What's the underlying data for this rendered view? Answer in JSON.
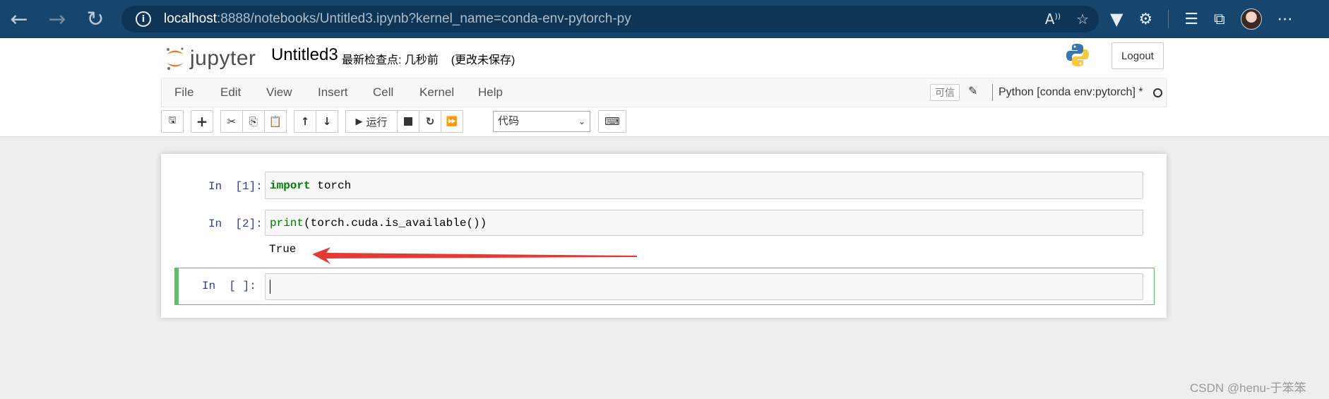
{
  "browser": {
    "url_host": "localhost",
    "url_rest": ":8888/notebooks/Untitled3.ipynb?kernel_name=conda-env-pytorch-py",
    "back_icon": "←",
    "forward_icon": "→",
    "reload_icon": "↻"
  },
  "header": {
    "logo_text": "jupyter",
    "notebook_title": "Untitled3",
    "checkpoint_status": "最新检查点: 几秒前",
    "save_status": "(更改未保存)",
    "logout_label": "Logout"
  },
  "menubar": {
    "items": [
      "File",
      "Edit",
      "View",
      "Insert",
      "Cell",
      "Kernel",
      "Help"
    ],
    "trusted_label": "可信",
    "kernel_name": "Python [conda env:pytorch] *"
  },
  "toolbar": {
    "run_label": "运行",
    "cell_type": "代码"
  },
  "cells": [
    {
      "prompt": "In  [1]:",
      "code_keyword": "import",
      "code_rest": " torch"
    },
    {
      "prompt": "In  [2]:",
      "code_builtin": "print",
      "code_rest": "(torch.cuda.is_available())",
      "output": "True"
    },
    {
      "prompt": "In  [ ]:",
      "code": ""
    }
  ],
  "watermark": "CSDN @henu-于笨笨"
}
